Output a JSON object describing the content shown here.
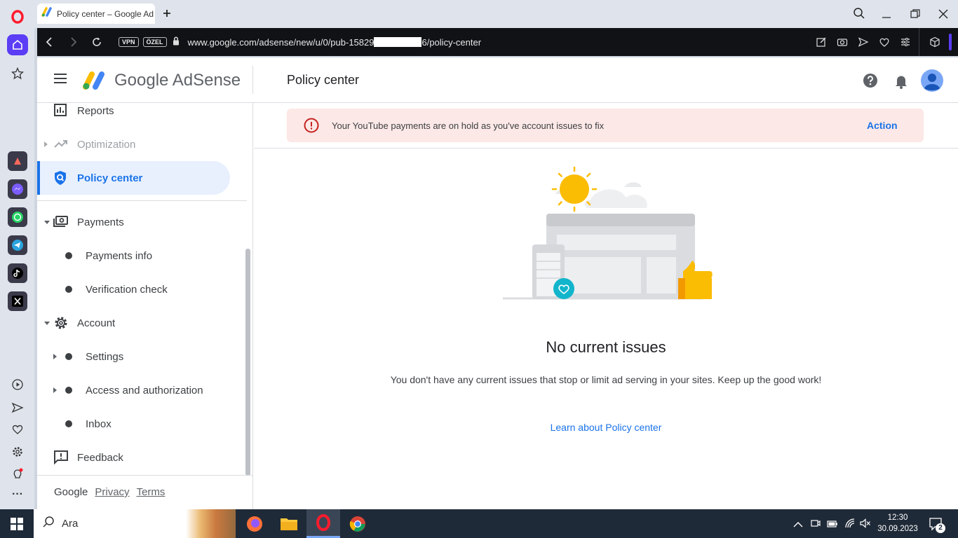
{
  "browser": {
    "tab_title": "Policy center – Google Ad",
    "vpn_label": "VPN",
    "private_label": "ÖZEL",
    "url_prefix": "www.google.com/adsense/new/u/0/pub-15829",
    "url_suffix": "6/policy-center"
  },
  "app": {
    "brand": "Google AdSense",
    "page_title": "Policy center"
  },
  "alert": {
    "message": "Your YouTube payments are on hold as you've account issues to fix",
    "action_label": "Action"
  },
  "sidebar": {
    "items": [
      {
        "label": "Reports",
        "icon": "bar-chart-icon"
      },
      {
        "label": "Optimization",
        "icon": "trending-up-icon"
      },
      {
        "label": "Policy center",
        "icon": "policy-shield-icon"
      },
      {
        "label": "Payments",
        "icon": "payments-icon"
      },
      {
        "label": "Payments info"
      },
      {
        "label": "Verification check"
      },
      {
        "label": "Account",
        "icon": "gear-icon"
      },
      {
        "label": "Settings"
      },
      {
        "label": "Access and authorization"
      },
      {
        "label": "Inbox"
      },
      {
        "label": "Feedback",
        "icon": "feedback-icon"
      }
    ],
    "footer": {
      "google": "Google",
      "privacy": "Privacy",
      "terms": "Terms"
    }
  },
  "empty_state": {
    "title": "No current issues",
    "body": "You don't have any current issues that stop or limit ad serving in your sites. Keep up the good work!",
    "link": "Learn about Policy center"
  },
  "taskbar": {
    "search_placeholder": "Ara",
    "time": "12:30",
    "date": "30.09.2023",
    "notification_count": "2"
  },
  "colors": {
    "accent_blue": "#1a73e8",
    "active_nav_bg": "#e8f0fe",
    "alert_bg": "#fce8e6",
    "alert_icon": "#c5221f",
    "opera_red": "#ff1b2d"
  }
}
